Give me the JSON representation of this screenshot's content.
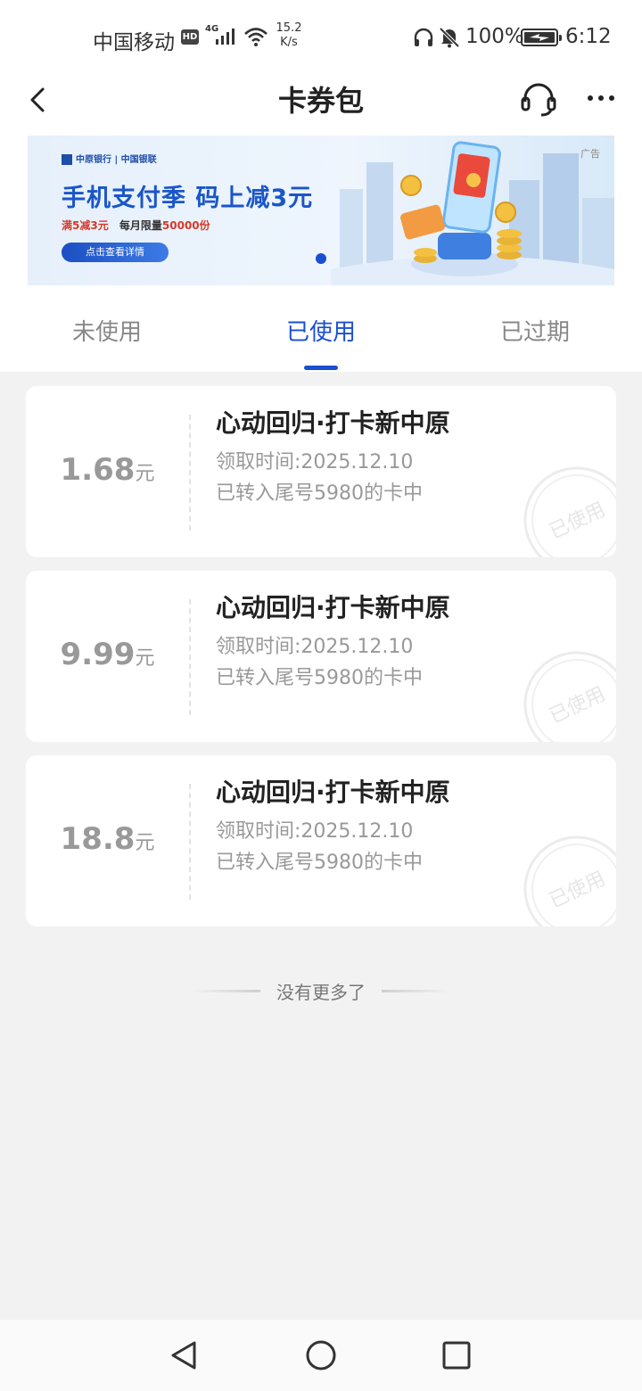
{
  "status_bar": {
    "carrier": "中国移动",
    "hd": "HD",
    "network": "4G",
    "speed_value": "15.2",
    "speed_unit": "K/s",
    "battery": "100%",
    "time": "6:12"
  },
  "header": {
    "title": "卡券包",
    "icons": [
      "back-icon",
      "headset-icon",
      "more-icon"
    ]
  },
  "banner": {
    "logo_text": "中原银行 | 中国银联",
    "headline": "手机支付季 码上减3元",
    "offer": "满5减3元",
    "limit_prefix": "每月限量",
    "limit_value": "50000份",
    "cta": "点击查看详情",
    "ad_label": "广告",
    "accent_color": "#1a56c8"
  },
  "tabs": {
    "items": [
      {
        "label": "未使用",
        "active": false
      },
      {
        "label": "已使用",
        "active": true
      },
      {
        "label": "已过期",
        "active": false
      }
    ],
    "active_color": "#1a4fd0"
  },
  "coupons": [
    {
      "amount": "1.68",
      "unit": "元",
      "title": "心动回归·打卡新中原",
      "date": "领取时间:2025.12.10",
      "card": "已转入尾号5980的卡中",
      "stamp": "已使用"
    },
    {
      "amount": "9.99",
      "unit": "元",
      "title": "心动回归·打卡新中原",
      "date": "领取时间:2025.12.10",
      "card": "已转入尾号5980的卡中",
      "stamp": "已使用"
    },
    {
      "amount": "18.8",
      "unit": "元",
      "title": "心动回归·打卡新中原",
      "date": "领取时间:2025.12.10",
      "card": "已转入尾号5980的卡中",
      "stamp": "已使用"
    }
  ],
  "end_note": "没有更多了",
  "nav_bar": {
    "icons": [
      "nav-back-icon",
      "nav-home-icon",
      "nav-recent-icon"
    ]
  }
}
